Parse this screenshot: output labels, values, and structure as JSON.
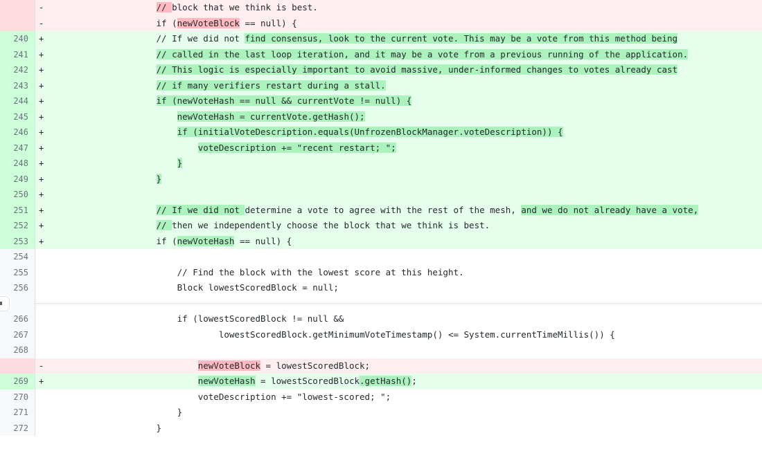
{
  "view": {
    "kind": "unified-diff",
    "language": "java",
    "colors": {
      "addition_bg": "#e6ffed",
      "addition_word_bg": "#acf2bd",
      "deletion_bg": "#ffeef0",
      "deletion_word_bg": "#fdb8c0",
      "context_bg": "#ffffff",
      "gutter_bg": "#f6f8fa",
      "gutter_text": "#6a737d",
      "code_text": "#24292e",
      "border": "#dfe2e5"
    },
    "expander": {
      "label": "expand-hunk",
      "glyph": "↕"
    }
  },
  "rows": [
    {
      "old": "",
      "new": "",
      "marker": "-",
      "type": "del",
      "segments": [
        {
          "t": "                    ",
          "h": "none"
        },
        {
          "t": "// ",
          "h": "del"
        },
        {
          "t": "block that we think is best.",
          "h": "none"
        }
      ]
    },
    {
      "old": "",
      "new": "",
      "marker": "-",
      "type": "del",
      "segments": [
        {
          "t": "                    if (",
          "h": "none"
        },
        {
          "t": "newVoteBlock",
          "h": "del"
        },
        {
          "t": " == null) {",
          "h": "none"
        }
      ]
    },
    {
      "old": "",
      "new": "240",
      "marker": "+",
      "type": "add",
      "segments": [
        {
          "t": "                    // If we did not ",
          "h": "none"
        },
        {
          "t": "find consensus, look to the current vote. This may be a vote from this method being",
          "h": "add"
        }
      ]
    },
    {
      "old": "",
      "new": "241",
      "marker": "+",
      "type": "add",
      "segments": [
        {
          "t": "                    ",
          "h": "none"
        },
        {
          "t": "// called in the last loop iteration, and it may be a vote from a previous running of the application.",
          "h": "add"
        }
      ]
    },
    {
      "old": "",
      "new": "242",
      "marker": "+",
      "type": "add",
      "segments": [
        {
          "t": "                    ",
          "h": "none"
        },
        {
          "t": "// This logic is especially important to avoid massive, under-informed changes to votes already cast",
          "h": "add"
        }
      ]
    },
    {
      "old": "",
      "new": "243",
      "marker": "+",
      "type": "add",
      "segments": [
        {
          "t": "                    ",
          "h": "none"
        },
        {
          "t": "// if many verifiers restart during a stall.",
          "h": "add"
        }
      ]
    },
    {
      "old": "",
      "new": "244",
      "marker": "+",
      "type": "add",
      "segments": [
        {
          "t": "                    ",
          "h": "none"
        },
        {
          "t": "if (newVoteHash == null && currentVote != null) {",
          "h": "add"
        }
      ]
    },
    {
      "old": "",
      "new": "245",
      "marker": "+",
      "type": "add",
      "segments": [
        {
          "t": "                        ",
          "h": "none"
        },
        {
          "t": "newVoteHash = currentVote.getHash();",
          "h": "add"
        }
      ]
    },
    {
      "old": "",
      "new": "246",
      "marker": "+",
      "type": "add",
      "segments": [
        {
          "t": "                        ",
          "h": "none"
        },
        {
          "t": "if (initialVoteDescription.equals(UnfrozenBlockManager.voteDescription)) {",
          "h": "add"
        }
      ]
    },
    {
      "old": "",
      "new": "247",
      "marker": "+",
      "type": "add",
      "segments": [
        {
          "t": "                            ",
          "h": "none"
        },
        {
          "t": "voteDescription += \"recent restart; \";",
          "h": "add"
        }
      ]
    },
    {
      "old": "",
      "new": "248",
      "marker": "+",
      "type": "add",
      "segments": [
        {
          "t": "                        ",
          "h": "none"
        },
        {
          "t": "}",
          "h": "add"
        }
      ]
    },
    {
      "old": "",
      "new": "249",
      "marker": "+",
      "type": "add",
      "segments": [
        {
          "t": "                    ",
          "h": "none"
        },
        {
          "t": "}",
          "h": "add"
        }
      ]
    },
    {
      "old": "",
      "new": "250",
      "marker": "+",
      "type": "add",
      "segments": [
        {
          "t": "",
          "h": "none"
        }
      ]
    },
    {
      "old": "",
      "new": "251",
      "marker": "+",
      "type": "add",
      "segments": [
        {
          "t": "                    ",
          "h": "none"
        },
        {
          "t": "// If we did not ",
          "h": "add"
        },
        {
          "t": "determine a vote to agree with the rest of the mesh, ",
          "h": "none"
        },
        {
          "t": "and we do not already have a vote,",
          "h": "add"
        }
      ]
    },
    {
      "old": "",
      "new": "252",
      "marker": "+",
      "type": "add",
      "segments": [
        {
          "t": "                    ",
          "h": "none"
        },
        {
          "t": "// ",
          "h": "add"
        },
        {
          "t": "then we independently choose the block that we think is best.",
          "h": "none"
        }
      ]
    },
    {
      "old": "",
      "new": "253",
      "marker": "+",
      "type": "add",
      "segments": [
        {
          "t": "                    if (",
          "h": "none"
        },
        {
          "t": "newVoteHash",
          "h": "add"
        },
        {
          "t": " == null) {",
          "h": "none"
        }
      ]
    },
    {
      "old": "",
      "new": "254",
      "marker": " ",
      "type": "ctx",
      "segments": [
        {
          "t": "",
          "h": "none"
        }
      ]
    },
    {
      "old": "",
      "new": "255",
      "marker": " ",
      "type": "ctx",
      "segments": [
        {
          "t": "                        // Find the block with the lowest score at this height.",
          "h": "none"
        }
      ]
    },
    {
      "old": "",
      "new": "256",
      "marker": " ",
      "type": "ctx",
      "segments": [
        {
          "t": "                        Block lowestScoredBlock = null;",
          "h": "none"
        }
      ]
    },
    {
      "type": "expander",
      "old": "",
      "new": "",
      "marker": "",
      "segments": []
    },
    {
      "old": "",
      "new": "266",
      "marker": " ",
      "type": "ctx",
      "segments": [
        {
          "t": "                        if (lowestScoredBlock != null &&",
          "h": "none"
        }
      ]
    },
    {
      "old": "",
      "new": "267",
      "marker": " ",
      "type": "ctx",
      "segments": [
        {
          "t": "                                lowestScoredBlock.getMinimumVoteTimestamp() <= System.currentTimeMillis()) {",
          "h": "none"
        }
      ]
    },
    {
      "old": "",
      "new": "268",
      "marker": " ",
      "type": "ctx",
      "segments": [
        {
          "t": "",
          "h": "none"
        }
      ]
    },
    {
      "old": "",
      "new": "",
      "marker": "-",
      "type": "del",
      "segments": [
        {
          "t": "                            ",
          "h": "none"
        },
        {
          "t": "newVoteBlock",
          "h": "del"
        },
        {
          "t": " = lowestScoredBlock;",
          "h": "none"
        }
      ]
    },
    {
      "old": "",
      "new": "269",
      "marker": "+",
      "type": "add",
      "segments": [
        {
          "t": "                            ",
          "h": "none"
        },
        {
          "t": "newVoteHash",
          "h": "add"
        },
        {
          "t": " = lowestScoredBlock",
          "h": "none"
        },
        {
          "t": ".getHash()",
          "h": "add"
        },
        {
          "t": ";",
          "h": "none"
        }
      ]
    },
    {
      "old": "",
      "new": "270",
      "marker": " ",
      "type": "ctx",
      "segments": [
        {
          "t": "                            voteDescription += \"lowest-scored; \";",
          "h": "none"
        }
      ]
    },
    {
      "old": "",
      "new": "271",
      "marker": " ",
      "type": "ctx",
      "segments": [
        {
          "t": "                        }",
          "h": "none"
        }
      ]
    },
    {
      "old": "",
      "new": "272",
      "marker": " ",
      "type": "ctx",
      "segments": [
        {
          "t": "                    }",
          "h": "none"
        }
      ]
    }
  ]
}
